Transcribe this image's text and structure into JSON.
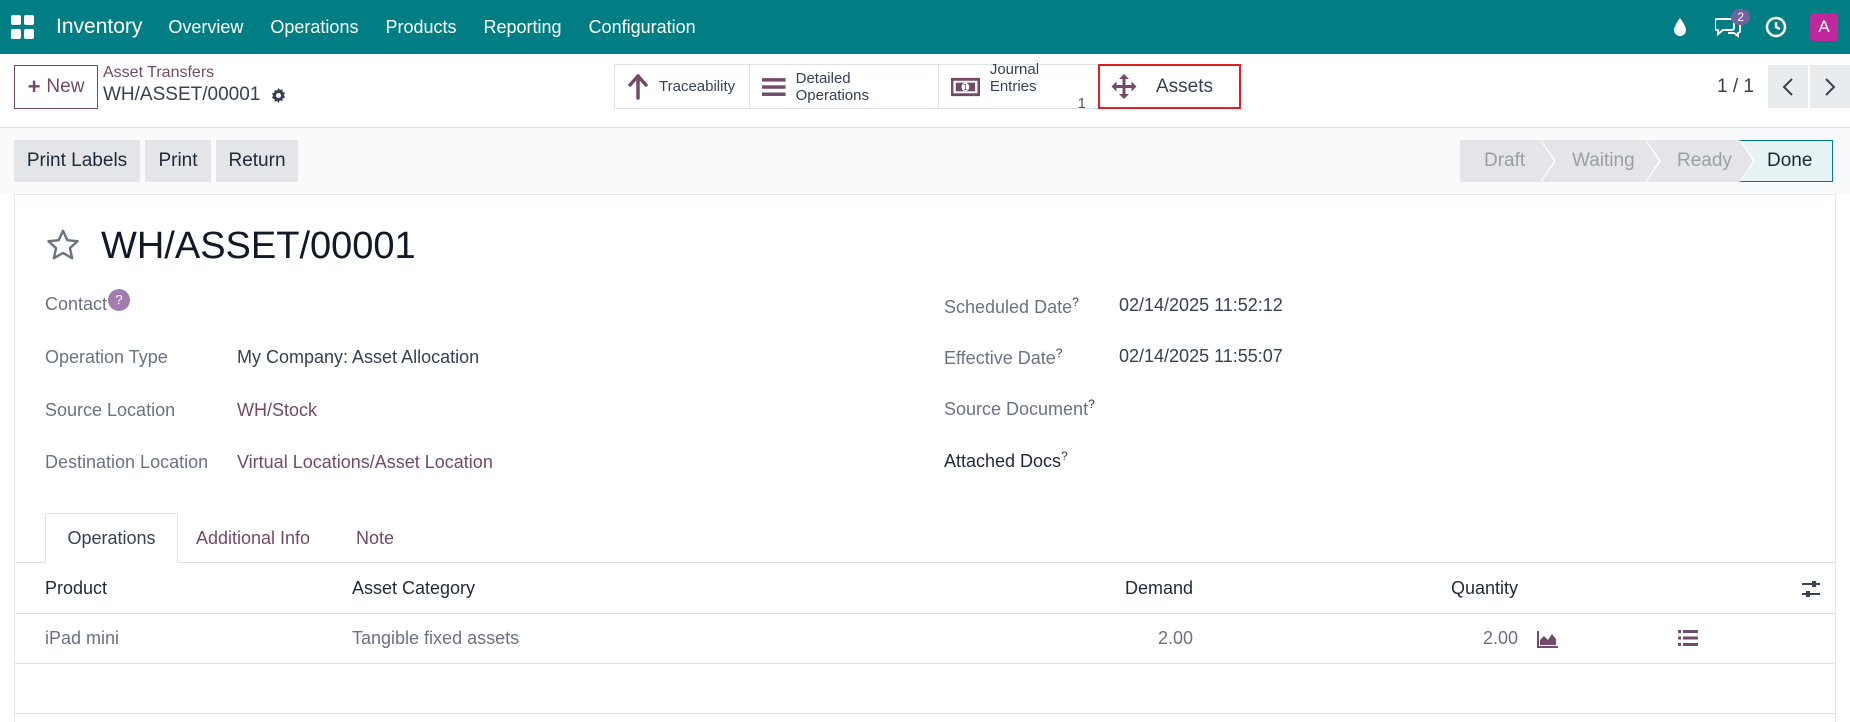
{
  "navbar": {
    "app_name": "Inventory",
    "menu": [
      "Overview",
      "Operations",
      "Products",
      "Reporting",
      "Configuration"
    ],
    "messages_count": "2",
    "avatar_letter": "A",
    "icons": [
      "apps-grid-icon",
      "droplet-icon",
      "chat-icon",
      "clock-icon"
    ]
  },
  "control_panel": {
    "new_label": "New",
    "breadcrumb": "Asset Transfers",
    "record": "WH/ASSET/00001",
    "smart_buttons": {
      "traceability": "Traceability",
      "detailed_operations": "Detailed Operations",
      "journal_entries": "Journal Entries",
      "journal_entries_count": "1",
      "assets": "Assets"
    },
    "pager": "1 / 1"
  },
  "actions": {
    "print_labels": "Print Labels",
    "print": "Print",
    "return": "Return"
  },
  "status": {
    "stages": [
      "Draft",
      "Waiting",
      "Ready",
      "Done"
    ],
    "current": "Done"
  },
  "form": {
    "title": "WH/ASSET/00001",
    "contact_label": "Contact",
    "contact_help": "?",
    "operation_type_label": "Operation Type",
    "operation_type_value": "My Company: Asset Allocation",
    "source_location_label": "Source Location",
    "source_location_value": "WH/Stock",
    "destination_location_label": "Destination Location",
    "destination_location_value": "Virtual Locations/Asset Location",
    "scheduled_date_label": "Scheduled Date",
    "scheduled_date_value": "02/14/2025 11:52:12",
    "effective_date_label": "Effective Date",
    "effective_date_value": "02/14/2025 11:55:07",
    "source_document_label": "Source Document",
    "attached_docs_label": "Attached Docs",
    "help_mark": "?"
  },
  "tabs": [
    "Operations",
    "Additional Info",
    "Note"
  ],
  "table": {
    "headers": {
      "product": "Product",
      "asset_category": "Asset Category",
      "demand": "Demand",
      "quantity": "Quantity"
    },
    "rows": [
      {
        "product": "iPad mini",
        "asset_category": "Tangible fixed assets",
        "demand": "2.00",
        "quantity": "2.00"
      }
    ]
  },
  "colors": {
    "navbar": "#017e84",
    "accent": "#714b67",
    "highlight_border": "#e02020"
  }
}
